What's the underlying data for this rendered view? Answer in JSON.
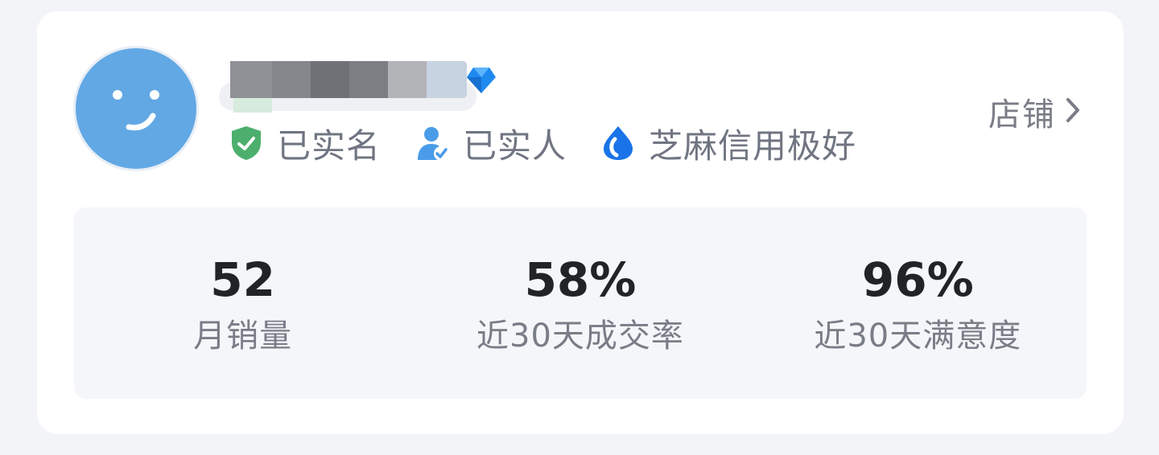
{
  "seller": {
    "badges": [
      {
        "icon": "shield-check-icon",
        "label": "已实名",
        "color": "#4caf6d"
      },
      {
        "icon": "person-verified-icon",
        "label": "已实人",
        "color": "#4a9ce8"
      },
      {
        "icon": "sesame-credit-icon",
        "label": "芝麻信用极好",
        "color": "#1a73e8"
      }
    ],
    "level_icon": "diamond-icon",
    "shop_link_label": "店铺"
  },
  "stats": [
    {
      "value": "52",
      "label": "月销量"
    },
    {
      "value": "58%",
      "label": "近30天成交率"
    },
    {
      "value": "96%",
      "label": "近30天满意度"
    }
  ],
  "colors": {
    "avatar_bg": "#62a8e4",
    "page_bg": "#f3f4f8",
    "card_bg": "#ffffff",
    "stats_bg": "#f5f6fa"
  }
}
